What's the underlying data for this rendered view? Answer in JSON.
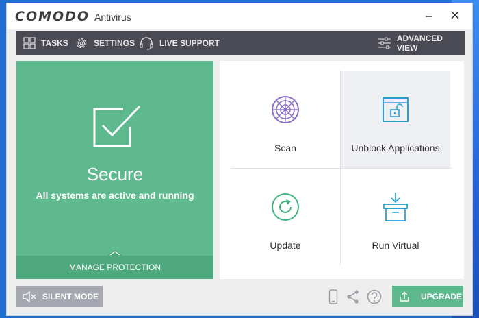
{
  "window": {
    "brand": "COMODO",
    "product": "Antivirus",
    "minimize_glyph": "—",
    "close_glyph": "✕"
  },
  "toolbar": {
    "tasks_label": "TASKS",
    "settings_label": "SETTINGS",
    "live_support_label": "LIVE SUPPORT",
    "advanced_view_label": "ADVANCED VIEW",
    "icons": [
      "grid-icon",
      "gear-icon",
      "headset-icon",
      "sliders-icon"
    ]
  },
  "status": {
    "title": "Secure",
    "subtitle": "All systems are active and running",
    "manage_label": "MANAGE PROTECTION",
    "icon": "checkbox-icon"
  },
  "tiles": [
    {
      "label": "Scan",
      "icon": "radar-icon"
    },
    {
      "label": "Unblock Applications",
      "icon": "unlock-window-icon"
    },
    {
      "label": "Update",
      "icon": "refresh-icon"
    },
    {
      "label": "Run Virtual",
      "icon": "box-arrow-icon"
    }
  ],
  "footer": {
    "silent_mode_label": "SILENT MODE",
    "upgrade_label": "UPGRADE",
    "icons": [
      "mute-speaker-icon",
      "phone-icon",
      "share-icon",
      "help-icon",
      "upload-icon"
    ]
  },
  "colors": {
    "accent_green": "#5fb98e",
    "accent_green_dark": "#4fa97f",
    "toolbar_bg": "#4a4a55",
    "scan_icon": "#8a6fc7",
    "unblock_icon": "#2a9fd6",
    "update_icon": "#3fb47e",
    "run_virtual_icon": "#2a9fd6",
    "silent_bg": "#a5a8b0"
  }
}
